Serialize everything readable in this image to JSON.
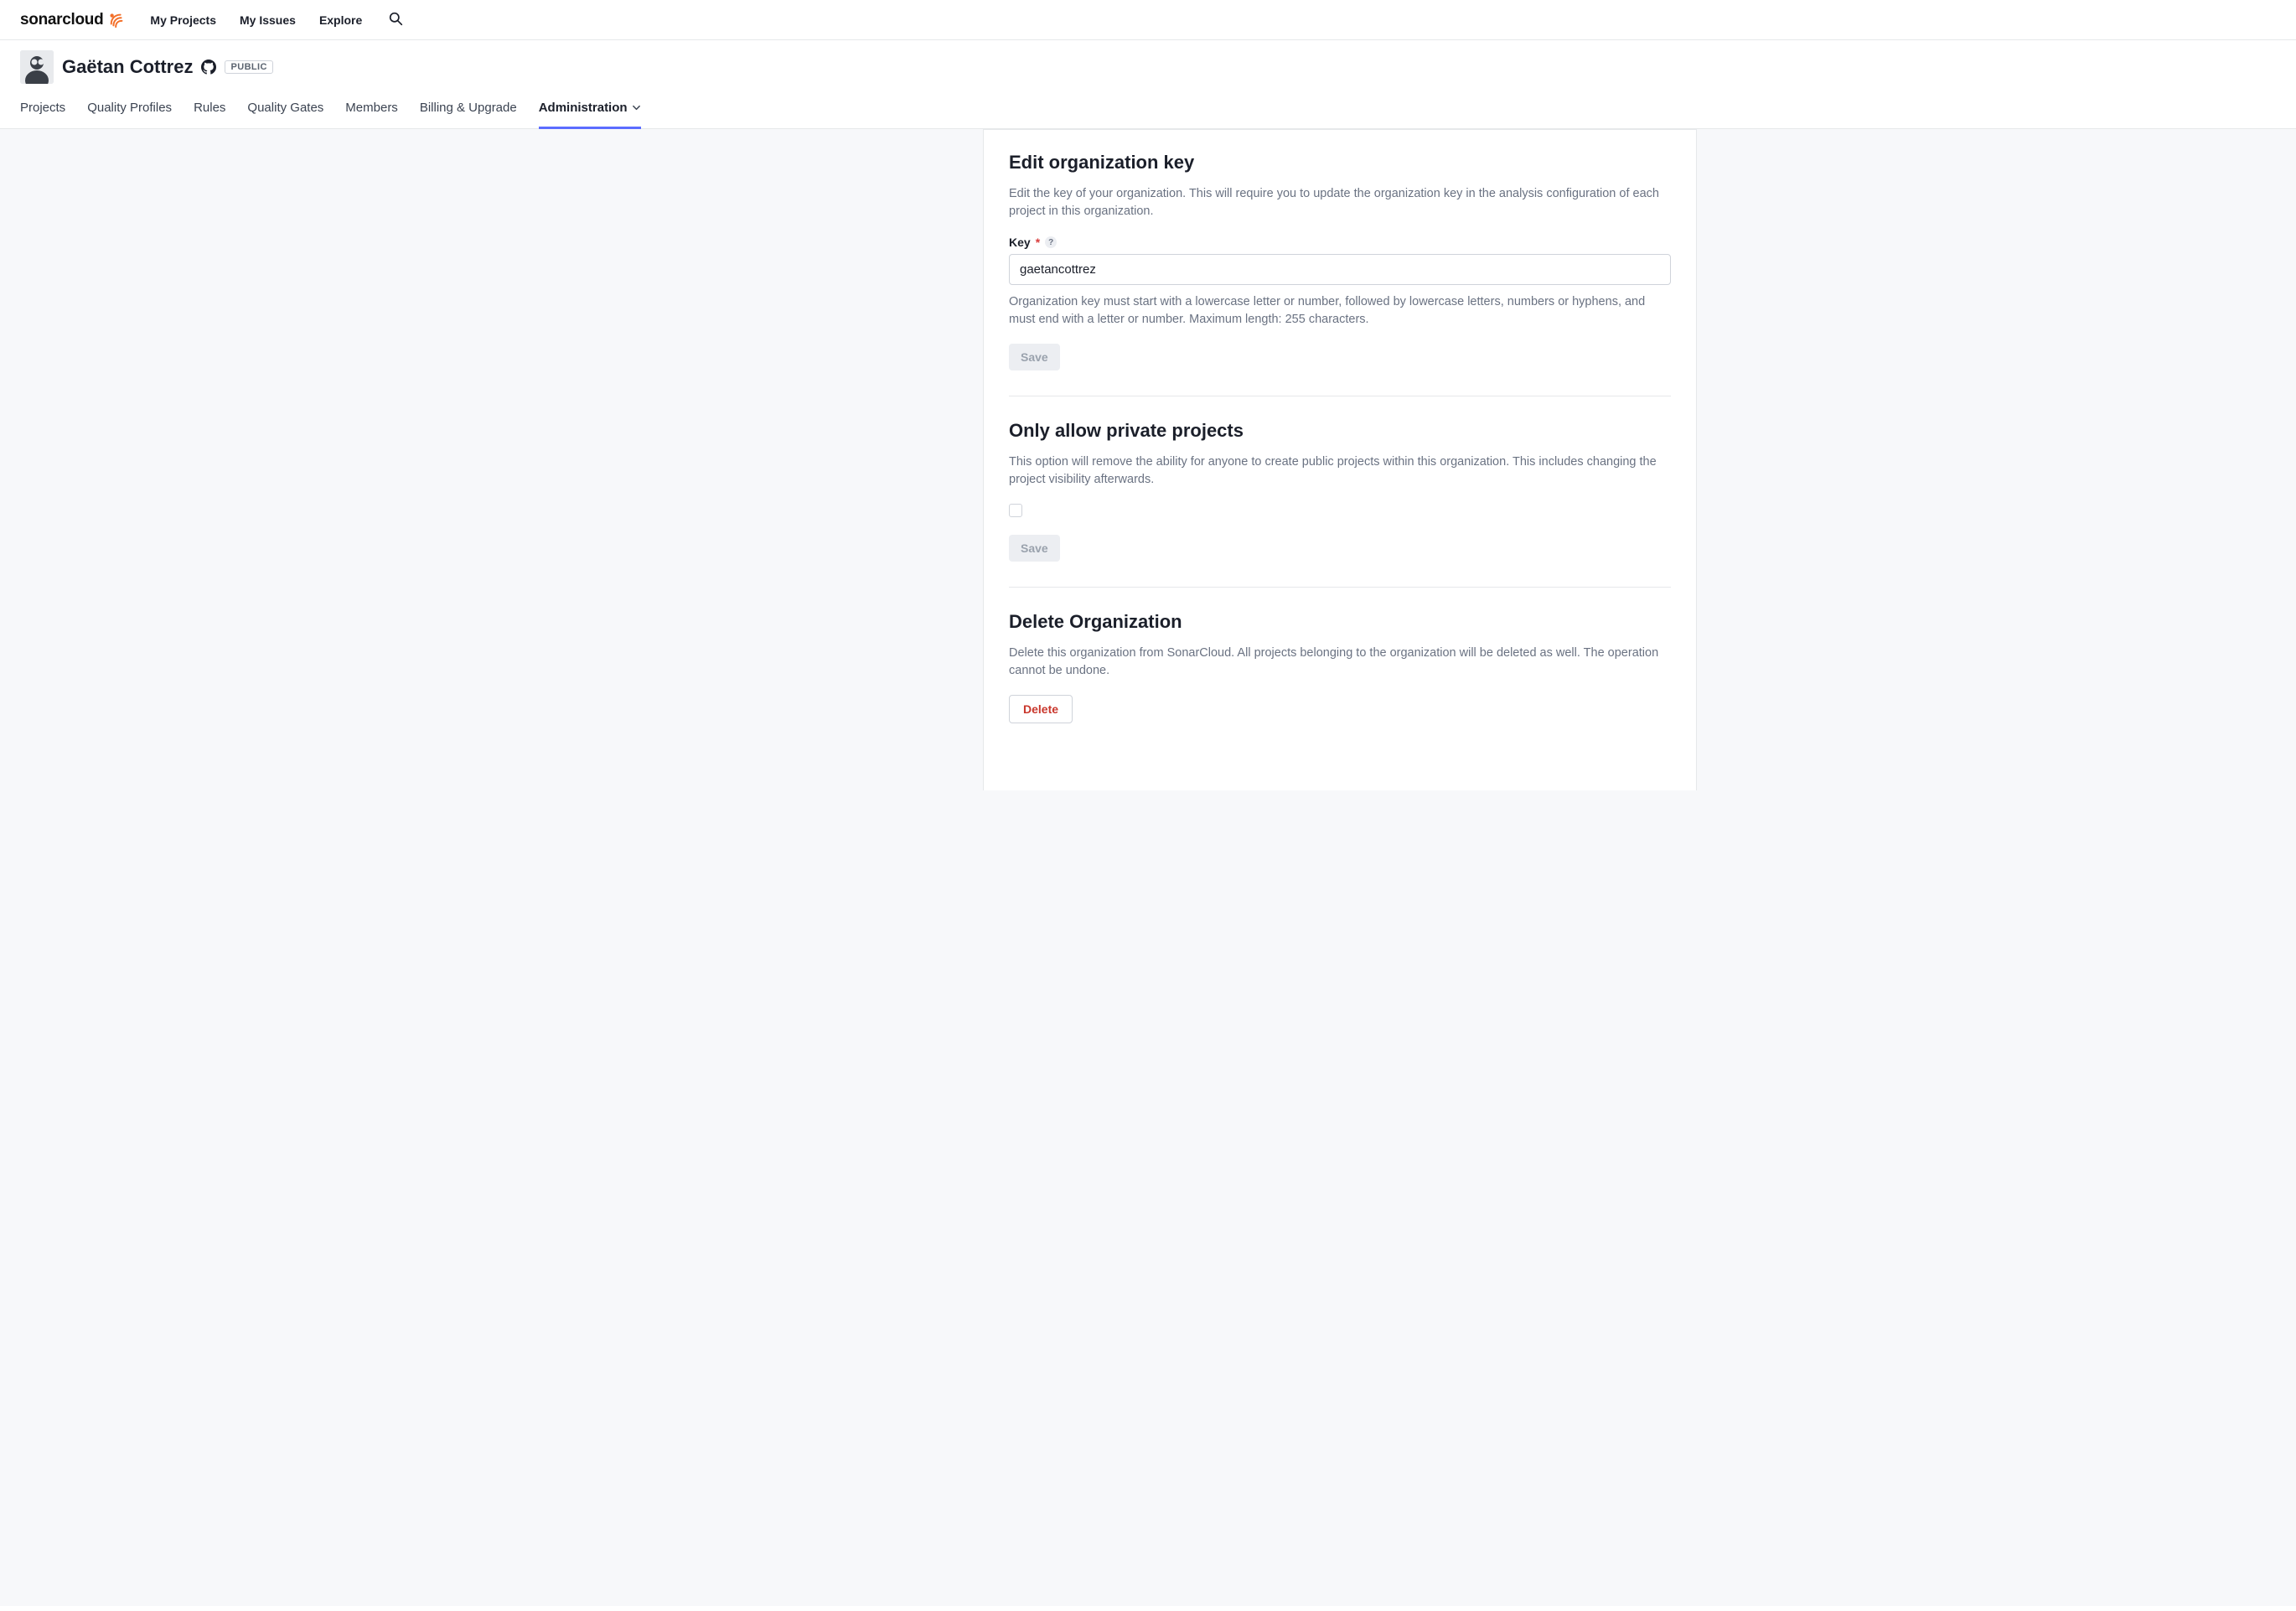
{
  "topnav": {
    "logo_text": "sonarcloud",
    "items": [
      "My Projects",
      "My Issues",
      "Explore"
    ]
  },
  "org": {
    "name": "Gaëtan Cottrez",
    "visibility": "PUBLIC",
    "tabs": [
      "Projects",
      "Quality Profiles",
      "Rules",
      "Quality Gates",
      "Members",
      "Billing & Upgrade",
      "Administration"
    ]
  },
  "sections": {
    "edit_key": {
      "title": "Edit organization key",
      "desc": "Edit the key of your organization. This will require you to update the organization key in the analysis configuration of each project in this organization.",
      "field_label": "Key",
      "value": "gaetancottrez",
      "hint": "Organization key must start with a lowercase letter or number, followed by lowercase letters, numbers or hyphens, and must end with a letter or number. Maximum length: 255 characters.",
      "save": "Save"
    },
    "private": {
      "title": "Only allow private projects",
      "desc": "This option will remove the ability for anyone to create public projects within this organization. This includes changing the project visibility afterwards.",
      "save": "Save"
    },
    "delete": {
      "title": "Delete Organization",
      "desc": "Delete this organization from SonarCloud. All projects belonging to the organization will be deleted as well. The operation cannot be undone.",
      "button": "Delete"
    }
  }
}
